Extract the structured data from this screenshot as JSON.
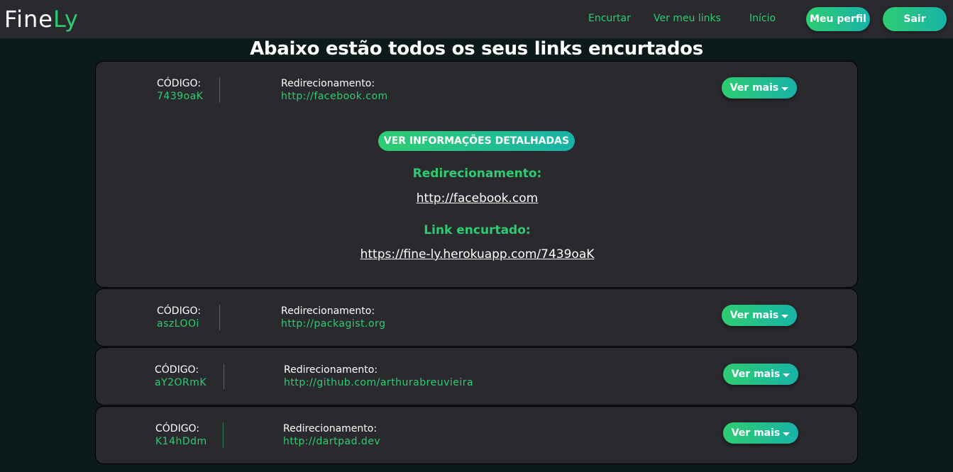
{
  "brand": {
    "name_part1": "Fine",
    "name_part2": "Ly"
  },
  "nav": {
    "shorten": "Encurtar",
    "my_links": "Ver meu links",
    "home": "Início",
    "profile": "Meu perfil",
    "logout": "Sair"
  },
  "page_title": "Abaixo estão todos os seus links encurtados",
  "labels": {
    "code": "CÓDIGO:",
    "redirect": "Redirecionamento:",
    "see_more": "Ver mais",
    "details_badge": "VER INFORMAÇÕES DETALHADAS",
    "detail_redirect": "Redirecionamento:",
    "detail_short": "Link encurtado:"
  },
  "links": [
    {
      "code": "7439oaK",
      "redirect": "http://facebook.com",
      "expanded": true,
      "detail_redirect_url": "http://facebook.com",
      "detail_short_url": "https://fine-ly.herokuapp.com/7439oaK"
    },
    {
      "code": "aszLOOi",
      "redirect": "http://packagist.org"
    },
    {
      "code": "aY2ORmK",
      "redirect": "http://github.com/arthurabreuvieira"
    },
    {
      "code": "K14hDdm",
      "redirect": "http://dartpad.dev"
    }
  ],
  "colors": {
    "accent": "#2ecc71",
    "accent2": "#18b3a8",
    "card": "#2a2a2e",
    "bg": "#0c1a1a"
  }
}
